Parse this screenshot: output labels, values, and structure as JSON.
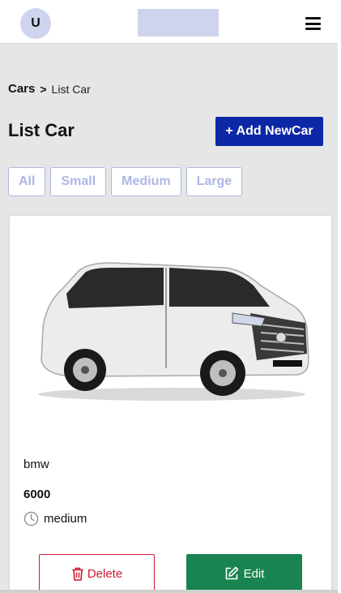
{
  "header": {
    "avatar_initial": "U"
  },
  "breadcrumb": {
    "root": "Cars",
    "separator": ">",
    "current": "List Car"
  },
  "page": {
    "title": "List Car",
    "add_button": "+ Add NewCar"
  },
  "filters": [
    "All",
    "Small",
    "Medium",
    "Large"
  ],
  "card": {
    "name": "bmw",
    "price": "6000",
    "size": "medium",
    "delete_label": "Delete",
    "edit_label": "Edit",
    "image_icon": "car-photo-icon",
    "size_icon": "clock-icon"
  },
  "colors": {
    "primary": "#0d28a6",
    "filter_border": "#aeb7e4",
    "danger": "#d0192f",
    "success": "#1a8451",
    "logo_placeholder": "#cfd4ee"
  }
}
